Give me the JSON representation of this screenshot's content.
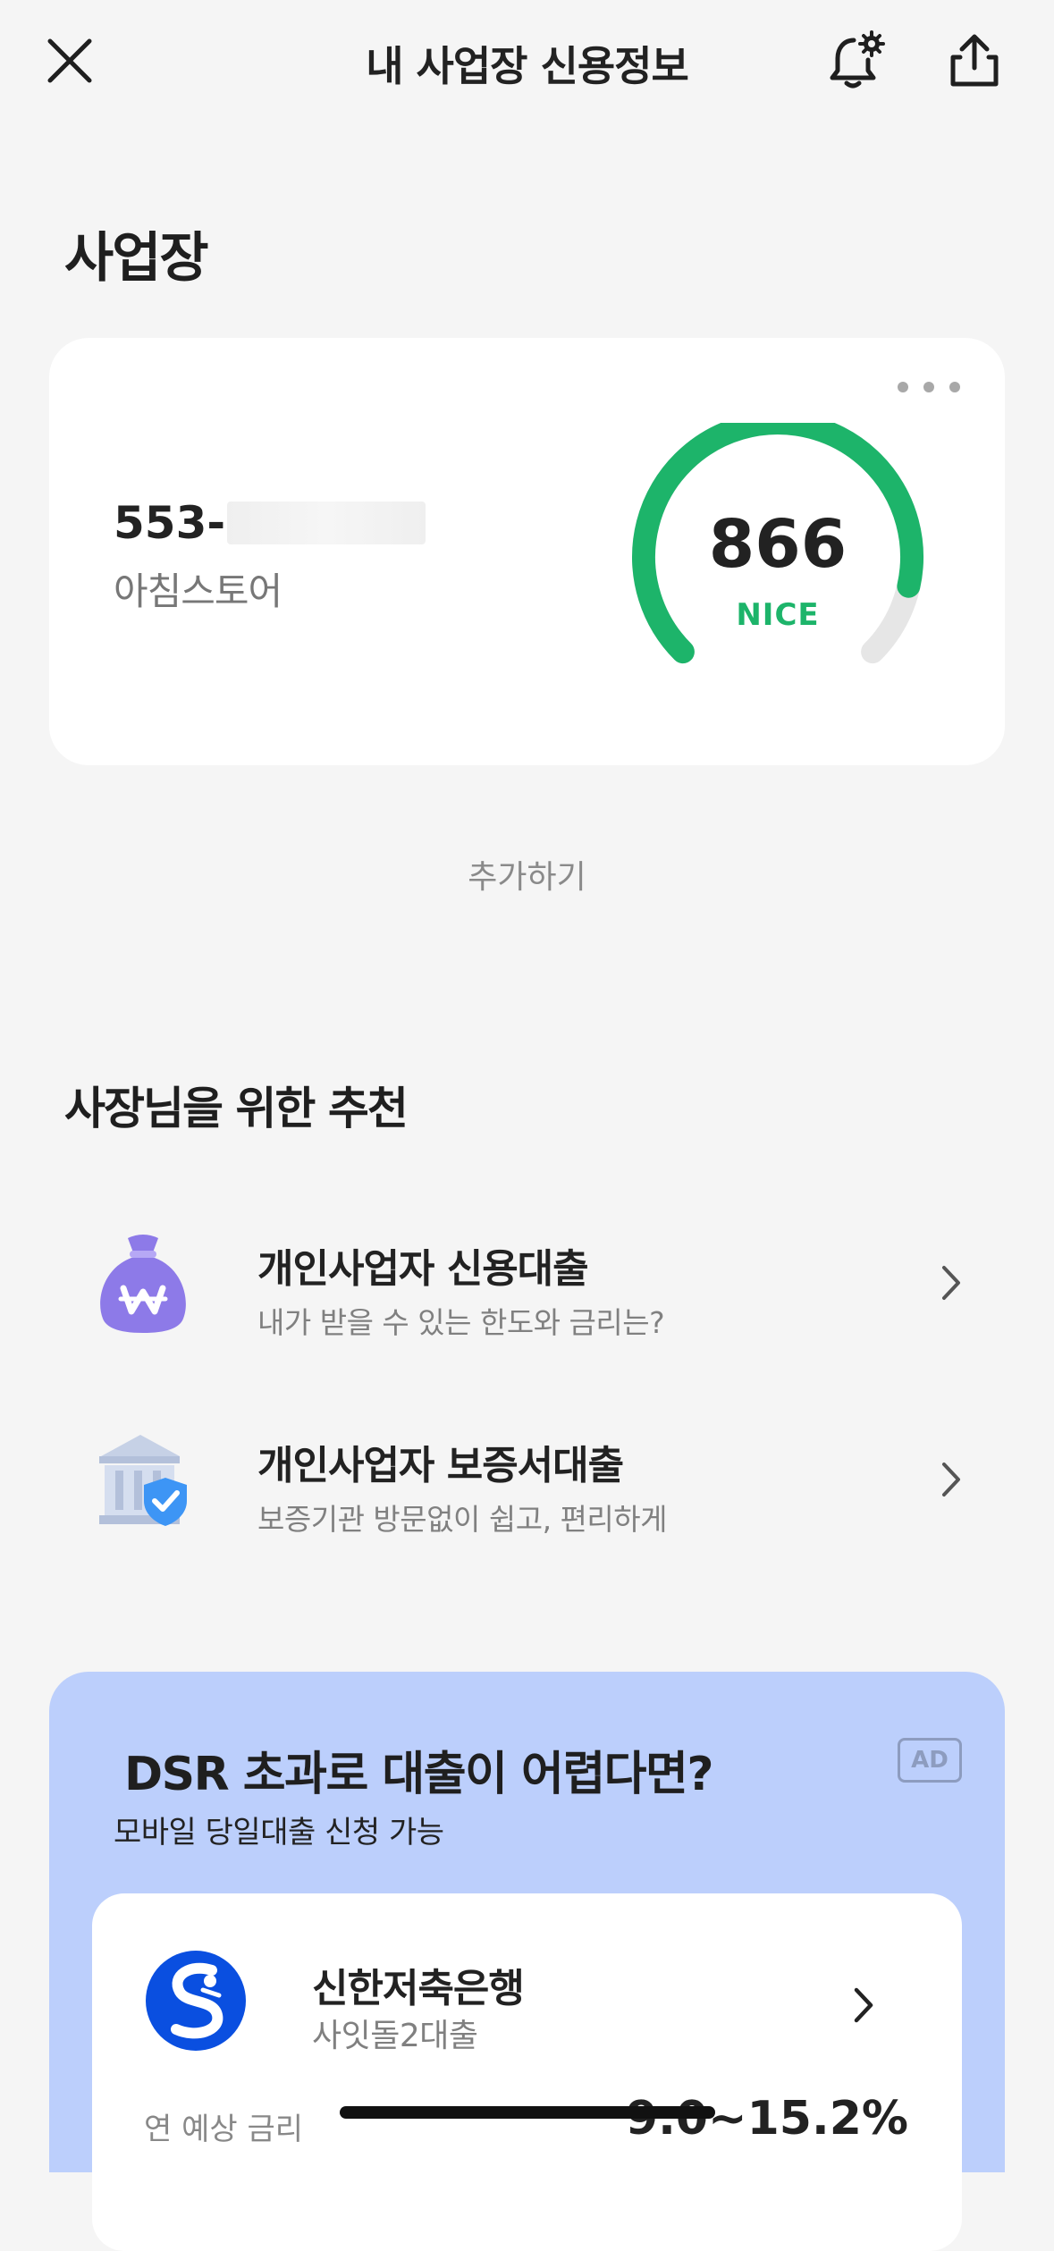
{
  "header": {
    "title": "내 사업장 신용정보",
    "icons": {
      "close": "close-icon",
      "bell": "bell-settings-icon",
      "share": "share-icon"
    }
  },
  "business": {
    "section_title": "사업장",
    "number_prefix": "553-",
    "name": "아침스토어",
    "score": "866",
    "agency": "NICE",
    "score_fraction": 0.88,
    "gauge_color": "#1db46a",
    "add_label": "추가하기"
  },
  "recommend": {
    "section_title": "사장님을 위한 추천",
    "items": [
      {
        "title": "개인사업자 신용대출",
        "subtitle": "내가 받을 수 있는 한도와 금리는?",
        "icon": "money-bag-icon"
      },
      {
        "title": "개인사업자 보증서대출",
        "subtitle": "보증기관 방문없이 쉽고, 편리하게",
        "icon": "bank-shield-icon"
      }
    ]
  },
  "ad": {
    "title": "DSR 초과로 대출이 어렵다면?",
    "subtitle": "모바일 당일대출 신청 가능",
    "badge": "AD",
    "background": "#bccffc",
    "bank": {
      "name": "신한저축은행",
      "product": "사잇돌2대출",
      "rate_label": "연 예상 금리",
      "rate_value": "9.0~15.2%",
      "logo_color": "#0a4fe0"
    }
  }
}
